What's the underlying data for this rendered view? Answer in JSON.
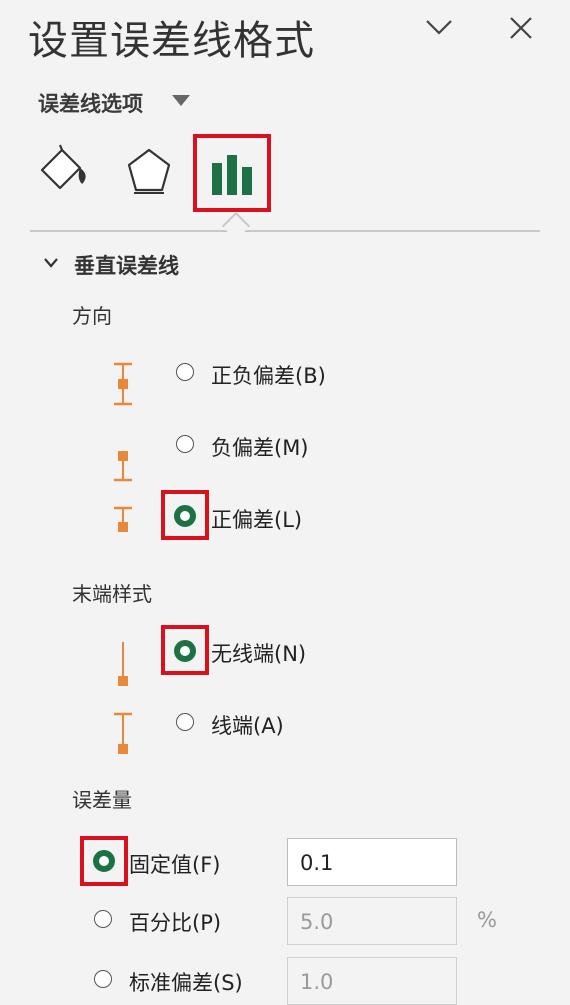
{
  "header": {
    "title": "设置误差线格式",
    "collapse_glyph": "⌵",
    "close_glyph": "✕"
  },
  "options_menu": {
    "label": "误差线选项"
  },
  "tabs": [
    {
      "name": "fill-line",
      "icon": "paint-bucket-icon"
    },
    {
      "name": "effects",
      "icon": "pentagon-icon"
    },
    {
      "name": "error-bar-options",
      "icon": "bar-chart-icon",
      "selected": true
    }
  ],
  "section": {
    "title": "垂直误差线"
  },
  "direction": {
    "label": "方向",
    "options": [
      {
        "label": "正负偏差(B)",
        "selected": false
      },
      {
        "label": "负偏差(M)",
        "selected": false
      },
      {
        "label": "正偏差(L)",
        "selected": true
      }
    ]
  },
  "end_style": {
    "label": "末端样式",
    "options": [
      {
        "label": "无线端(N)",
        "selected": true
      },
      {
        "label": "线端(A)",
        "selected": false
      }
    ]
  },
  "error_amount": {
    "label": "误差量",
    "options": [
      {
        "label": "固定值(F)",
        "selected": true,
        "value": "0.1"
      },
      {
        "label": "百分比(P)",
        "selected": false,
        "value": "5.0",
        "unit": "%"
      },
      {
        "label": "标准偏差(S)",
        "selected": false,
        "value": "1.0"
      }
    ]
  },
  "colors": {
    "accent_green": "#1e7145",
    "highlight_red": "#d9111c",
    "errorbar_orange": "#e8883a"
  }
}
